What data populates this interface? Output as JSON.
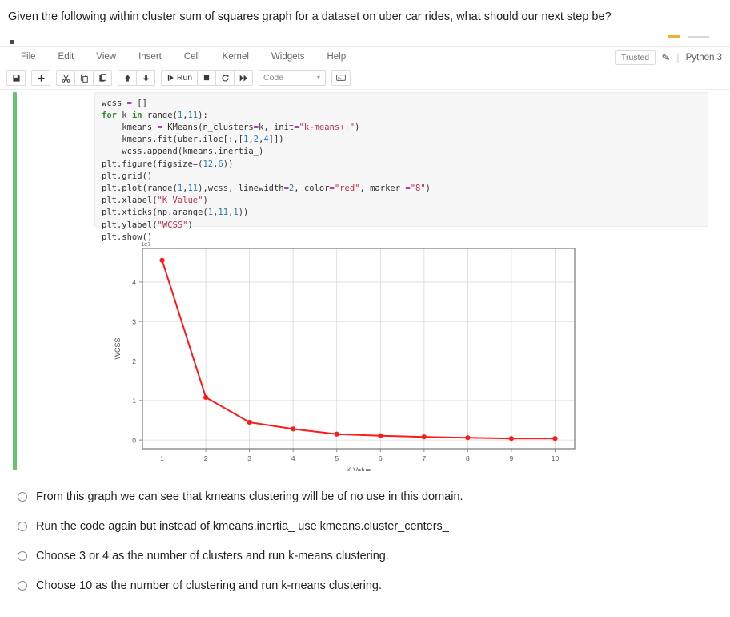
{
  "question": "Given the following within cluster sum of squares graph for a dataset on uber car rides, what should our next step be?",
  "notebook": {
    "menus": [
      "File",
      "Edit",
      "View",
      "Insert",
      "Cell",
      "Kernel",
      "Widgets",
      "Help"
    ],
    "trusted_label": "Trusted",
    "kernel_name": "Python 3",
    "toolbar": {
      "save_title": "Save",
      "add_title": "Insert cell below",
      "cut_title": "Cut cells",
      "copy_title": "Copy cells",
      "paste_title": "Paste cells below",
      "up_title": "Move cell up",
      "down_title": "Move cell down",
      "run_label": "Run",
      "stop_title": "Interrupt kernel",
      "restart_title": "Restart kernel",
      "fastforward_title": "Restart and run all",
      "cell_type": "Code",
      "palette_title": "Open command palette"
    },
    "code": {
      "lines": [
        [
          [
            "f",
            "wcss "
          ],
          [
            "o",
            "= "
          ],
          [
            "f",
            "[]"
          ]
        ],
        [
          [
            "k",
            "for "
          ],
          [
            "f",
            "k "
          ],
          [
            "k",
            "in "
          ],
          [
            "f",
            "range("
          ],
          [
            "n",
            "1"
          ],
          [
            "f",
            ","
          ],
          [
            "n",
            "11"
          ],
          [
            "f",
            "):"
          ]
        ],
        [
          [
            "f",
            "    kmeans "
          ],
          [
            "o",
            "= "
          ],
          [
            "f",
            "KMeans(n_clusters"
          ],
          [
            "o",
            "="
          ],
          [
            "f",
            "k, init"
          ],
          [
            "o",
            "="
          ],
          [
            "s",
            "\"k-means++\""
          ],
          [
            "f",
            ")"
          ]
        ],
        [
          [
            "f",
            "    kmeans.fit(uber.iloc[:,["
          ],
          [
            "n",
            "1"
          ],
          [
            "f",
            ","
          ],
          [
            "n",
            "2"
          ],
          [
            "f",
            ","
          ],
          [
            "n",
            "4"
          ],
          [
            "f",
            "]])"
          ]
        ],
        [
          [
            "f",
            "    wcss.append(kmeans.inertia_)"
          ]
        ],
        [
          [
            "f",
            "plt.figure(figsize"
          ],
          [
            "o",
            "="
          ],
          [
            "f",
            "("
          ],
          [
            "n",
            "12"
          ],
          [
            "f",
            ","
          ],
          [
            "n",
            "6"
          ],
          [
            "f",
            "))"
          ]
        ],
        [
          [
            "f",
            "plt.grid()"
          ]
        ],
        [
          [
            "f",
            "plt.plot(range("
          ],
          [
            "n",
            "1"
          ],
          [
            "f",
            ","
          ],
          [
            "n",
            "11"
          ],
          [
            "f",
            "),wcss, linewidth"
          ],
          [
            "o",
            "="
          ],
          [
            "n",
            "2"
          ],
          [
            "f",
            ", color"
          ],
          [
            "o",
            "="
          ],
          [
            "s",
            "\"red\""
          ],
          [
            "f",
            ", marker "
          ],
          [
            "o",
            "="
          ],
          [
            "s",
            "\"8\""
          ],
          [
            "f",
            ")"
          ]
        ],
        [
          [
            "f",
            "plt.xlabel("
          ],
          [
            "s",
            "\"K Value\""
          ],
          [
            "f",
            ")"
          ]
        ],
        [
          [
            "f",
            "plt.xticks(np.arange("
          ],
          [
            "n",
            "1"
          ],
          [
            "f",
            ","
          ],
          [
            "n",
            "11"
          ],
          [
            "f",
            ","
          ],
          [
            "n",
            "1"
          ],
          [
            "f",
            "))"
          ]
        ],
        [
          [
            "f",
            "plt.ylabel("
          ],
          [
            "s",
            "\"WCSS\""
          ],
          [
            "f",
            ")"
          ]
        ],
        [
          [
            "f",
            "plt.show()"
          ]
        ]
      ]
    }
  },
  "chart_data": {
    "type": "line",
    "title": "",
    "xlabel": "K Value",
    "ylabel": "WCSS",
    "y_offset_text": "1e7",
    "y_scale_factor": 10000000,
    "x": [
      1,
      2,
      3,
      4,
      5,
      6,
      7,
      8,
      9,
      10
    ],
    "values": [
      45500000,
      10800000,
      4500000,
      2800000,
      1500000,
      1100000,
      800000,
      600000,
      400000,
      400000
    ],
    "values_scaled": [
      4.55,
      1.08,
      0.45,
      0.28,
      0.15,
      0.11,
      0.08,
      0.06,
      0.04,
      0.04
    ],
    "xticks": [
      1,
      2,
      3,
      4,
      5,
      6,
      7,
      8,
      9,
      10
    ],
    "yticks": [
      0,
      1,
      2,
      3,
      4
    ],
    "xlim": [
      0.55,
      10.45
    ],
    "ylim": [
      -0.22,
      4.85
    ],
    "grid": true,
    "series_color": "#ff1a1a",
    "marker": "circle",
    "linewidth": 2,
    "legend": "none"
  },
  "options": [
    {
      "id": "opt-a",
      "label": "From this graph we can see that kmeans clustering will be of no use in this domain."
    },
    {
      "id": "opt-b",
      "label": "Run the code again but instead of kmeans.inertia_  use kmeans.cluster_centers_"
    },
    {
      "id": "opt-c",
      "label": "Choose 3 or 4 as the number of clusters and run k-means clustering."
    },
    {
      "id": "opt-d",
      "label": "Choose 10  as the number of clustering and run k-means clustering."
    }
  ]
}
